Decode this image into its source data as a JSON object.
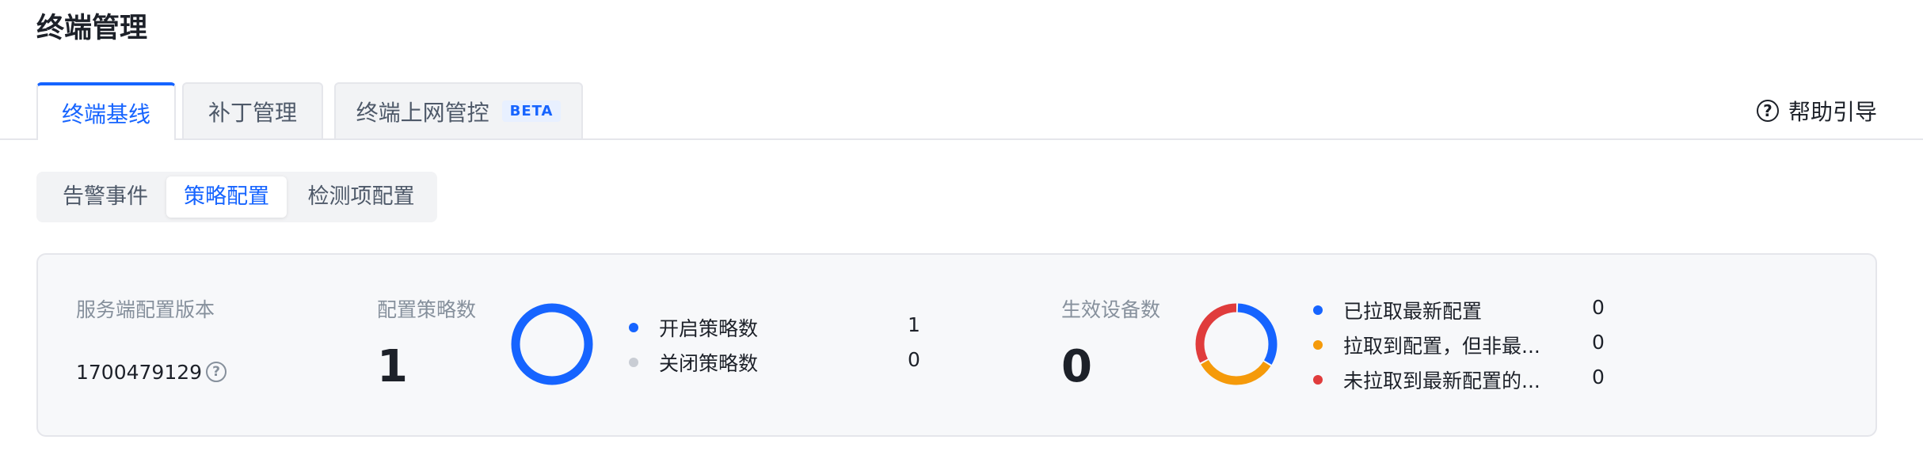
{
  "page": {
    "title": "终端管理"
  },
  "tabs": [
    {
      "label": "终端基线",
      "active": true
    },
    {
      "label": "补丁管理",
      "active": false
    },
    {
      "label": "终端上网管控",
      "active": false,
      "badge": "BETA"
    }
  ],
  "help": {
    "label": "帮助引导",
    "icon": "question-circle-icon"
  },
  "subtabs": [
    {
      "label": "告警事件",
      "active": false
    },
    {
      "label": "策略配置",
      "active": true
    },
    {
      "label": "检测项配置",
      "active": false
    }
  ],
  "summary": {
    "server_version": {
      "label": "服务端配置版本",
      "value": "1700479129"
    },
    "policy": {
      "label": "配置策略数",
      "total": "1",
      "legend": [
        {
          "label": "开启策略数",
          "value": "1",
          "color": "#1664ff"
        },
        {
          "label": "关闭策略数",
          "value": "0",
          "color": "#c9cdd4"
        }
      ]
    },
    "devices": {
      "label": "生效设备数",
      "total": "0",
      "legend": [
        {
          "label": "已拉取最新配置",
          "value": "0",
          "color": "#1664ff"
        },
        {
          "label": "拉取到配置，但非最...",
          "value": "0",
          "color": "#f59a0a"
        },
        {
          "label": "未拉取到最新配置的...",
          "value": "0",
          "color": "#e03c3c"
        }
      ]
    }
  },
  "colors": {
    "primary": "#1664ff",
    "orange": "#f59a0a",
    "red": "#e03c3c",
    "gray": "#c9cdd4"
  }
}
